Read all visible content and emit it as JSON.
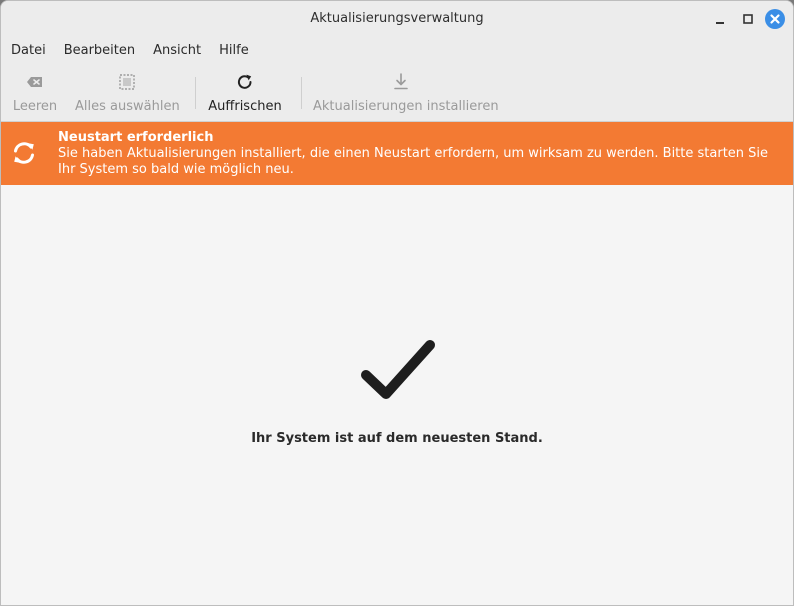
{
  "window": {
    "title": "Aktualisierungsverwaltung"
  },
  "menu": [
    "Datei",
    "Bearbeiten",
    "Ansicht",
    "Hilfe"
  ],
  "toolbar": {
    "clear_label": "Leeren",
    "select_all_label": "Alles auswählen",
    "refresh_label": "Auffrischen",
    "install_label": "Aktualisierungen installieren"
  },
  "banner": {
    "title": "Neustart erforderlich",
    "text": "Sie haben Aktualisierungen installiert, die einen Neustart erfordern, um wirksam zu werden. Bitte starten Sie Ihr System so bald wie möglich neu.",
    "color": "#f37a33"
  },
  "content": {
    "status": "Ihr System ist auf dem neuesten Stand."
  }
}
